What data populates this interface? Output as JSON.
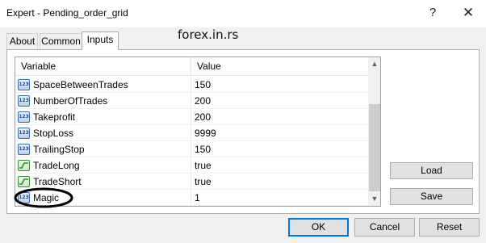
{
  "window": {
    "title": "Expert - Pending_order_grid",
    "help_glyph": "?",
    "close_glyph": "✕"
  },
  "watermark": "forex.in.rs",
  "tabs": [
    {
      "label": "About",
      "active": false
    },
    {
      "label": "Common",
      "active": false
    },
    {
      "label": "Inputs",
      "active": true
    }
  ],
  "grid": {
    "headers": {
      "variable": "Variable",
      "value": "Value"
    },
    "rows": [
      {
        "name": "SpaceBetweenTrades",
        "value": "150",
        "icon": "numeric-icon"
      },
      {
        "name": "NumberOfTrades",
        "value": "200",
        "icon": "numeric-icon"
      },
      {
        "name": "Takeprofit",
        "value": "200",
        "icon": "numeric-icon"
      },
      {
        "name": "StopLoss",
        "value": "9999",
        "icon": "numeric-icon"
      },
      {
        "name": "TrailingStop",
        "value": "150",
        "icon": "numeric-icon"
      },
      {
        "name": "TradeLong",
        "value": "true",
        "icon": "boolean-icon"
      },
      {
        "name": "TradeShort",
        "value": "true",
        "icon": "boolean-icon"
      },
      {
        "name": "Magic",
        "value": "1",
        "icon": "numeric-icon"
      }
    ],
    "numeric_icon_text": "123",
    "highlighted_row": "Magic"
  },
  "buttons": {
    "load": "Load",
    "save": "Save",
    "ok": "OK",
    "cancel": "Cancel",
    "reset": "Reset"
  },
  "colors": {
    "default_button_border": "#0078d7",
    "highlight_ellipse": "#000000"
  }
}
